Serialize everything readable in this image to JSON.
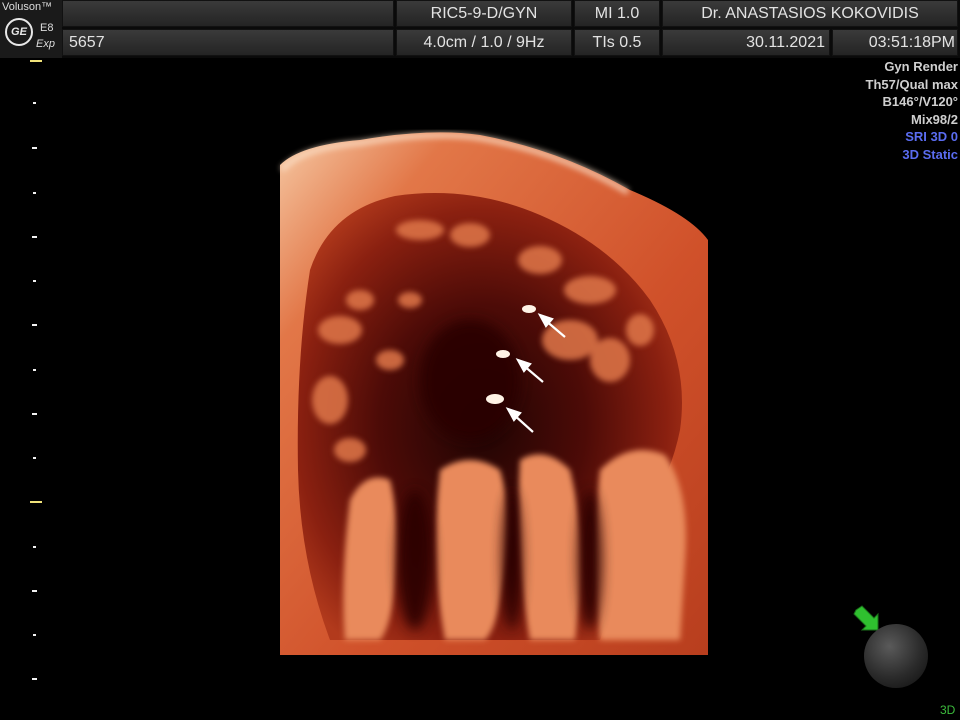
{
  "header": {
    "brand": "Voluson™",
    "model": "E8",
    "model_sub": "Exp",
    "logo_text": "GE",
    "patient_id": "5657",
    "probe": "RIC5-9-D/GYN",
    "depth_info": "4.0cm / 1.0 /  9Hz",
    "mi": "MI  1.0",
    "tis": "TIs  0.5",
    "doctor": "Dr. ANASTASIOS KOKOVIDIS",
    "date": "30.11.2021",
    "time": "03:51:18PM"
  },
  "params": {
    "line1": "Gyn Render",
    "line2": "Th57/Qual max",
    "line3": "B146°/V120°",
    "line4": "Mix98/2",
    "line5": "SRI 3D 0",
    "line6": "3D Static"
  },
  "mode_tag": "3D",
  "colors": {
    "tissue": "#d0512a",
    "tissue_dark": "#5a0d08",
    "param_blue": "#5a6cf0",
    "scale_highlight": "#f0e27a",
    "mode_green": "#3cba3c"
  }
}
